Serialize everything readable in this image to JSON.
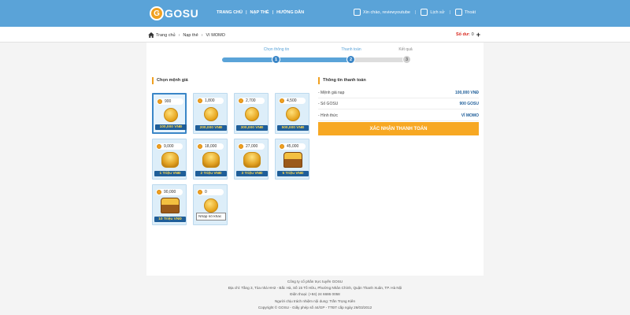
{
  "header": {
    "logo_letter": "G",
    "logo_text": "GOSU",
    "nav": [
      "TRANG CHỦ",
      "NẠP THẺ",
      "HƯỚNG DẪN"
    ],
    "nav_sep": "|",
    "user_greeting": "Xin chào, reviewyoutube",
    "history": "Lịch sử",
    "logout": "Thoát",
    "background_color": "#5aa3d8"
  },
  "breadcrumb": {
    "items": [
      "Trang chủ",
      "Nạp thẻ",
      "Ví MOMO"
    ],
    "sep": "›"
  },
  "balance": {
    "label": "Số dư:",
    "value": "0",
    "plus": "+"
  },
  "steps": [
    {
      "label": "Chọn thông tin",
      "number": "1",
      "state": "active"
    },
    {
      "label": "Thanh toán",
      "number": "2",
      "state": "active"
    },
    {
      "label": "Kết quả",
      "number": "3",
      "state": "inactive"
    }
  ],
  "denomination": {
    "title": "Chọn mệnh giá",
    "cards": [
      {
        "coins": "900",
        "price": "100,000 VNĐ",
        "art": "coin",
        "selected": true
      },
      {
        "coins": "1,800",
        "price": "200,000 VNĐ",
        "art": "coin"
      },
      {
        "coins": "2,700",
        "price": "300,000 VNĐ",
        "art": "coin"
      },
      {
        "coins": "4,500",
        "price": "500,000 VNĐ",
        "art": "coin"
      },
      {
        "coins": "9,000",
        "price": "1 Triệu VNĐ",
        "art": "pile"
      },
      {
        "coins": "18,000",
        "price": "2 Triệu VNĐ",
        "art": "pile"
      },
      {
        "coins": "27,000",
        "price": "3 Triệu VNĐ",
        "art": "pile"
      },
      {
        "coins": "45,000",
        "price": "5 Triệu VNĐ",
        "art": "chest"
      },
      {
        "coins": "90,000",
        "price": "10 Triệu VNĐ",
        "art": "chest"
      },
      {
        "coins": "0",
        "placeholder": "Nhập số khác",
        "art": "coin-custom"
      }
    ]
  },
  "payment": {
    "title": "Thông tin thanh toán",
    "rows": [
      {
        "label": "- Mệnh giá nạp",
        "value": "100,000 VNĐ"
      },
      {
        "label": "- Số GOSU",
        "value": "900 GOSU"
      },
      {
        "label": "- Hình thức",
        "value": "VÍ MOMO"
      }
    ],
    "confirm_label": "XÁC NHẬN THANH TOÁN",
    "confirm_color": "#f7a823"
  },
  "footer": {
    "lines": [
      "Công ty cổ phần trực tuyến GOSU",
      "Địa chỉ: Tầng 3, Tòa nhà HH2 - Bắc Hà, Số 15 Tố Hữu, Phường Nhân Chính, Quận Thanh Xuân, TP. Hà Nội",
      "Điện thoại: (+84) 24 6686 0058",
      "Người chịu trách nhiệm nội dung: Trần Trọng Kiên",
      "Copyright © GOSU - Giấy phép số 44/GP - TTĐT cấp ngày 26/03/2012"
    ]
  }
}
